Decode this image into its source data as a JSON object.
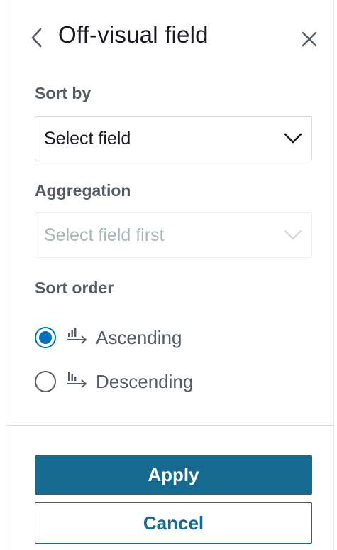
{
  "panel": {
    "title": "Off-visual field"
  },
  "sort_by": {
    "label": "Sort by",
    "selected": "Select field"
  },
  "aggregation": {
    "label": "Aggregation",
    "selected": "Select field first",
    "disabled": true
  },
  "sort_order": {
    "label": "Sort order",
    "options": [
      {
        "label": "Ascending",
        "icon": "sort-ascending-icon",
        "checked": true
      },
      {
        "label": "Descending",
        "icon": "sort-descending-icon",
        "checked": false
      }
    ]
  },
  "actions": {
    "apply_label": "Apply",
    "cancel_label": "Cancel"
  },
  "colors": {
    "primary": "#16698f",
    "radio_accent": "#0073bb",
    "label_text": "#545b64",
    "disabled_text": "#aab7b8"
  }
}
